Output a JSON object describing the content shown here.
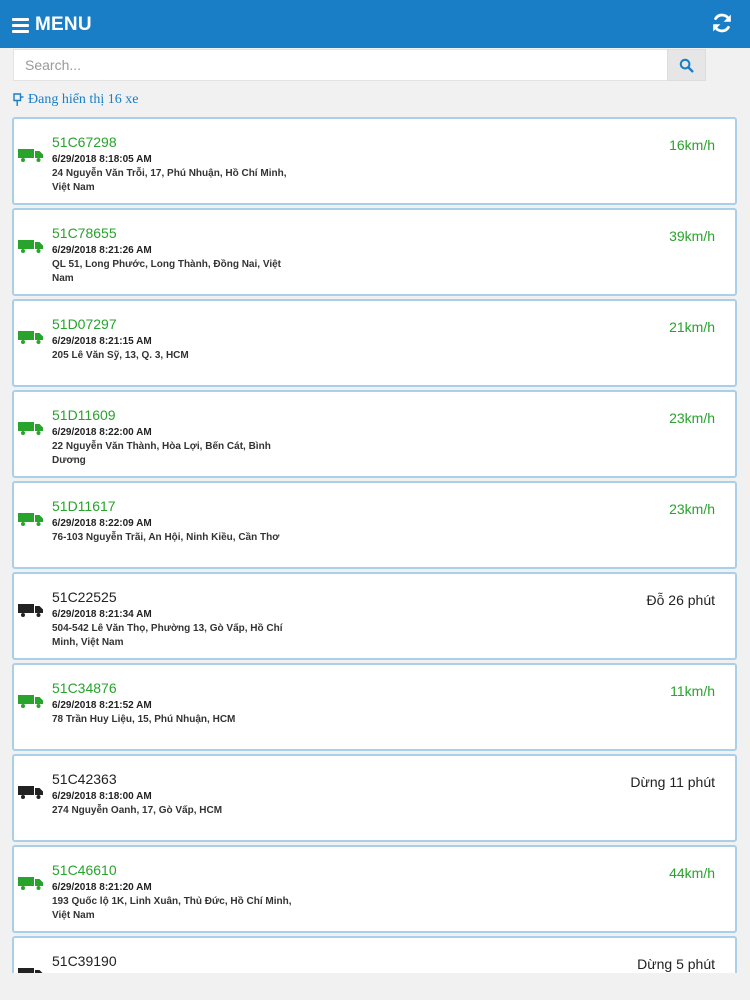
{
  "header": {
    "menu_label": "MENU"
  },
  "search": {
    "placeholder": "Search..."
  },
  "count_text": "Đang hiển thị 16 xe",
  "colors": {
    "primary": "#1a7ec6",
    "moving": "#28a32c",
    "stopped": "#222222",
    "card_border": "#a9cfe9"
  },
  "vehicles": [
    {
      "plate": "51C67298",
      "time": "6/29/2018 8:18:05 AM",
      "address": "24 Nguyễn Văn Trỗi, 17, Phú Nhuận, Hồ Chí Minh, Việt Nam",
      "status": "16km/h",
      "state": "moving"
    },
    {
      "plate": "51C78655",
      "time": "6/29/2018 8:21:26 AM",
      "address": "QL 51, Long Phước, Long Thành, Đồng Nai, Việt Nam",
      "status": "39km/h",
      "state": "moving"
    },
    {
      "plate": "51D07297",
      "time": "6/29/2018 8:21:15 AM",
      "address": "205 Lê Văn Sỹ, 13, Q. 3, HCM",
      "status": "21km/h",
      "state": "moving"
    },
    {
      "plate": "51D11609",
      "time": "6/29/2018 8:22:00 AM",
      "address": "22 Nguyễn Văn Thành, Hòa Lợi, Bến Cát, Bình Dương",
      "status": "23km/h",
      "state": "moving"
    },
    {
      "plate": "51D11617",
      "time": "6/29/2018 8:22:09 AM",
      "address": "76-103 Nguyễn Trãi, An Hội, Ninh Kiều, Cần Thơ",
      "status": "23km/h",
      "state": "moving"
    },
    {
      "plate": "51C22525",
      "time": "6/29/2018 8:21:34 AM",
      "address": "504-542 Lê Văn Thọ, Phường 13, Gò Vấp, Hồ Chí Minh, Việt Nam",
      "status": "Đỗ 26 phút",
      "state": "stopped"
    },
    {
      "plate": "51C34876",
      "time": "6/29/2018 8:21:52 AM",
      "address": "78 Trần Huy Liệu, 15, Phú Nhuận, HCM",
      "status": "11km/h",
      "state": "moving"
    },
    {
      "plate": "51C42363",
      "time": "6/29/2018 8:18:00 AM",
      "address": "274 Nguyễn Oanh, 17, Gò Vấp, HCM",
      "status": "Dừng 11 phút",
      "state": "stopped"
    },
    {
      "plate": "51C46610",
      "time": "6/29/2018 8:21:20 AM",
      "address": "193 Quốc lộ 1K, Linh Xuân, Thủ Đức, Hồ Chí Minh, Việt Nam",
      "status": "44km/h",
      "state": "moving"
    },
    {
      "plate": "51C39190",
      "time": "",
      "address": "",
      "status": "Dừng 5 phút",
      "state": "stopped"
    }
  ]
}
